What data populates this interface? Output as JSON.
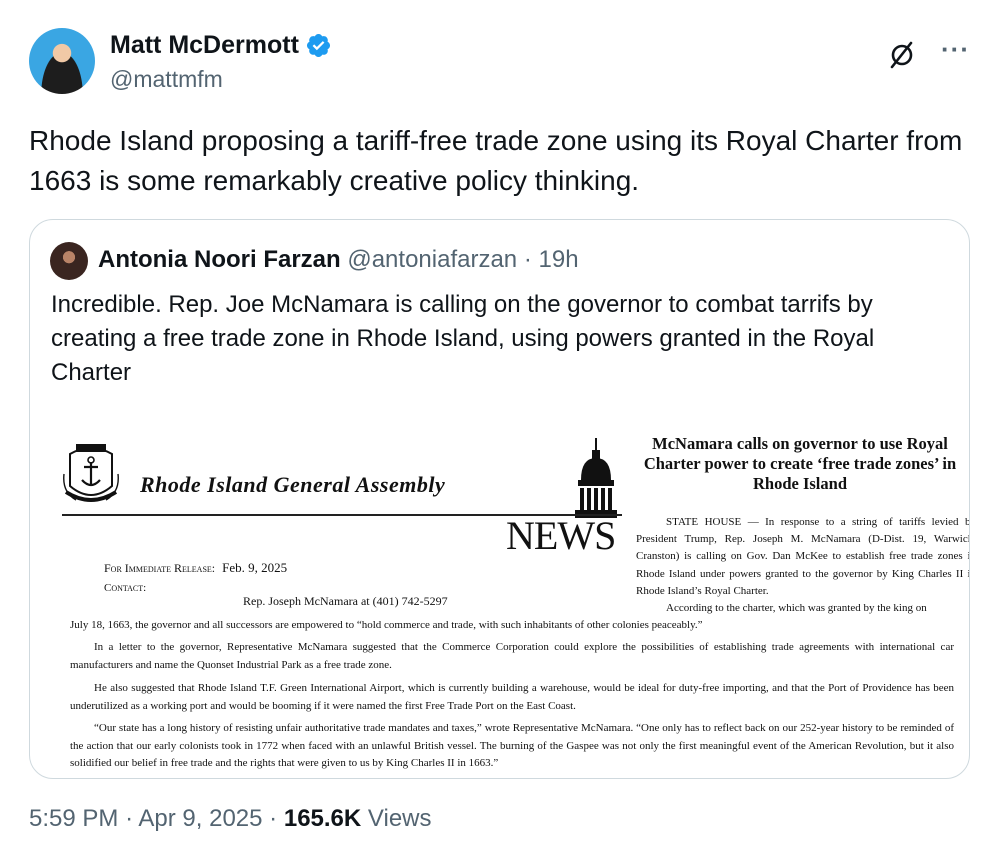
{
  "author": {
    "name": "Matt McDermott",
    "handle": "@mattmfm",
    "verified_color": "#1d9bf0"
  },
  "tweet": {
    "text": "Rhode Island proposing a tariff-free trade zone using its Royal Charter from 1663 is some remarkably creative policy thinking."
  },
  "icons": {
    "verified": "verified-badge-icon",
    "grok": "grok-icon",
    "more": "more-icon"
  },
  "quote": {
    "name": "Antonia Noori Farzan",
    "handle": "@antoniafarzan",
    "separator": "·",
    "time": "19h",
    "text": "Incredible. Rep. Joe McNamara is calling on the governor to combat tarrifs by creating a free trade zone in Rhode Island, using powers granted in the Royal Charter",
    "press_release": {
      "org": "Rhode Island General Assembly",
      "news": "NEWS",
      "headline": "McNamara calls on governor to use Royal Charter power to create ‘free trade zones’ in Rhode Island",
      "release_label": "For Immediate Release:",
      "release_date": "Feb. 9, 2025",
      "contact_label": "Contact:",
      "contact_value": "Rep. Joseph McNamara at (401) 742-5297",
      "right_col_1": "STATE HOUSE — In response to a string of tariffs levied by President Trump, Rep. Joseph M. McNamara (D-Dist. 19, Warwick, Cranston) is calling on Gov. Dan McKee to establish free trade zones in Rhode Island under powers granted to the governor by King Charles II in Rhode Island’s Royal Charter.",
      "right_col_2": "According to the charter, which was granted by the king on",
      "para_1": "July 18, 1663, the governor and all successors are empowered to “hold commerce and trade, with such inhabitants of other colonies peaceably.”",
      "para_2": "In a letter to the governor, Representative McNamara suggested that the Commerce Corporation could explore the possibilities of establishing trade agreements with international car manufacturers and name the Quonset Industrial Park as a free trade zone.",
      "para_3": "He also suggested that Rhode Island T.F. Green International Airport, which is currently building a warehouse, would be ideal for duty-free importing, and that the Port of Providence has been underutilized as a working port and would be booming if it were named the first Free Trade Port on the East Coast.",
      "para_4": "“Our state has a long history of resisting unfair authoritative trade mandates and taxes,” wrote Representative McNamara. “One only has to reflect back on our 252-year history to be reminded of the action that our early colonists took in 1772 when faced with an unlawful British vessel. The burning of the Gaspee was not only the first meaningful event of the American Revolution, but it also solidified our belief in free trade and the rights that were given to us by King Charles II in 1663.”"
    }
  },
  "footer": {
    "time": "5:59 PM",
    "sep1": "·",
    "date": "Apr 9, 2025",
    "sep2": "·",
    "views_count": "165.6K",
    "views_label": "Views"
  }
}
